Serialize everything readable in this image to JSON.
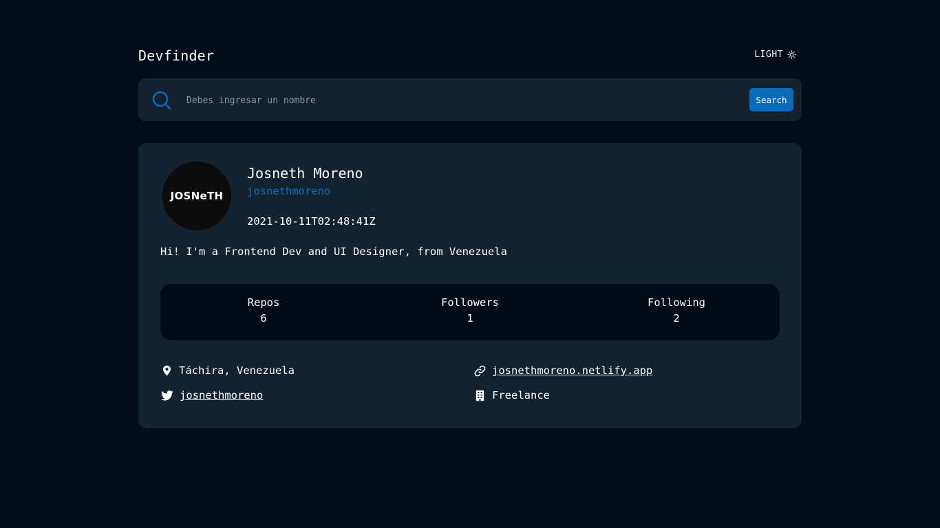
{
  "header": {
    "logo": "Devfinder",
    "theme_toggle_label": "LIGHT"
  },
  "search": {
    "placeholder": "Debes ingresar un nombre",
    "value": "",
    "button_label": "Search"
  },
  "profile": {
    "avatar_text": "JOSNeTH",
    "name": "Josneth Moreno",
    "login": "josnethmoreno",
    "created_at": "2021-10-11T02:48:41Z",
    "bio": "Hi! I'm a Frontend Dev and UI Designer, from Venezuela",
    "stats": [
      {
        "label": "Repos",
        "value": "6"
      },
      {
        "label": "Followers",
        "value": "1"
      },
      {
        "label": "Following",
        "value": "2"
      }
    ],
    "location": "Táchira, Venezuela",
    "blog": "josnethmoreno.netlify.app",
    "twitter": "josnethmoreno",
    "company": "Freelance"
  },
  "colors": {
    "background": "#020d18",
    "card": "#13222f",
    "accent": "#0b6bb8",
    "stats_background": "#020b15"
  }
}
